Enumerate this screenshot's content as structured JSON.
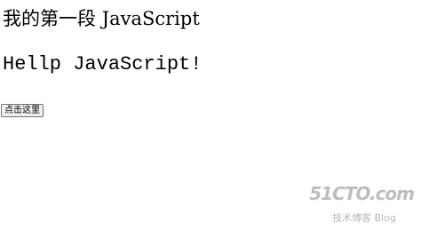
{
  "page": {
    "heading": "我的第一段 JavaScript",
    "paragraph": "Hellp JavaScript!",
    "button_label": "点击这里"
  },
  "watermark": {
    "logo": "51CTO.com",
    "subtitle": "技术博客 Blog"
  }
}
